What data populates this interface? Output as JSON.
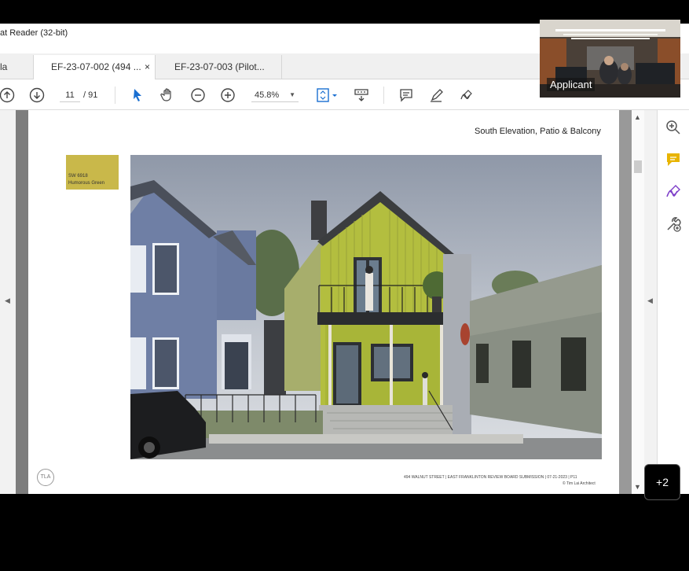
{
  "window": {
    "title": "at Reader (32-bit)"
  },
  "tabs": [
    {
      "label": "la"
    },
    {
      "label": "EF-23-07-002 (494 ...",
      "close": "×"
    },
    {
      "label": "EF-23-07-003 (Pilot..."
    }
  ],
  "toolbar": {
    "page_current": "11",
    "page_total": "/  91",
    "zoom": "45.8%",
    "icons": [
      "arrow-up-icon",
      "arrow-down-icon",
      "select-pointer-icon",
      "hand-icon",
      "zoom-out-icon",
      "zoom-in-icon",
      "fit-page-icon",
      "scroll-mode-icon",
      "comment-icon",
      "highlight-pen-icon",
      "sign-icon"
    ]
  },
  "document": {
    "header": "South Elevation, Patio & Balcony",
    "swatch": {
      "code": "SW 6918",
      "name": "Humorous Green",
      "color": "#c9b84a"
    },
    "logo": "TLA",
    "footer_line1": "494 WALNUT STREET | EAST FRANKLINTON REVIEW BOARD SUBMISSION | 07-21-2023 | P11",
    "footer_line2": "© Tim Lai Architect"
  },
  "sidepane": {
    "icons": [
      "zoom-search-icon",
      "comment-icon",
      "fill-sign-icon",
      "tools-icon"
    ]
  },
  "video": {
    "label": "Applicant"
  },
  "participants_more": "+2"
}
